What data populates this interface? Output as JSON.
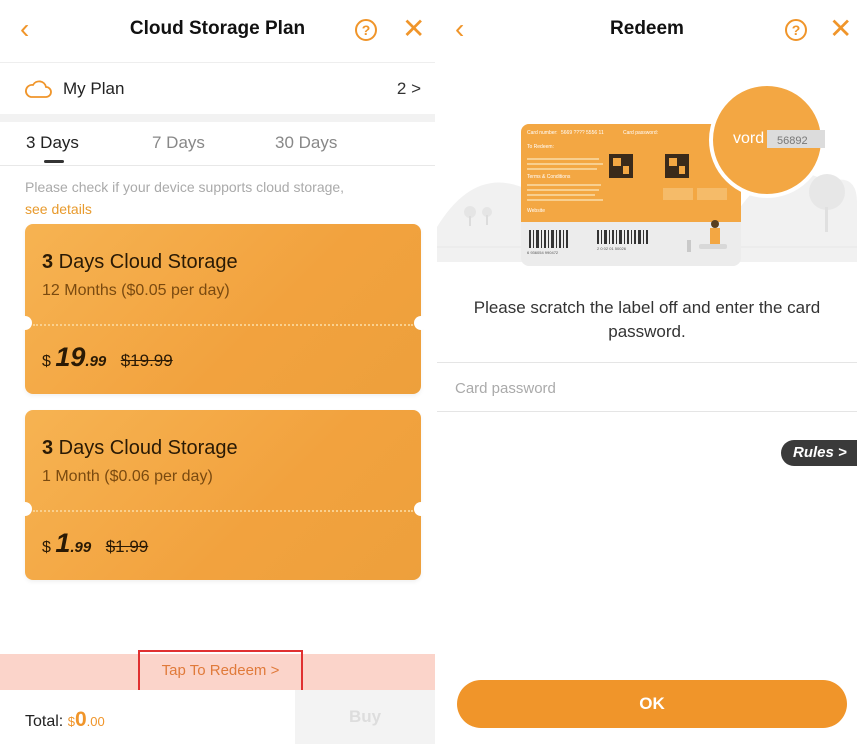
{
  "left": {
    "header": {
      "title": "Cloud Storage Plan",
      "help": "?",
      "close": "✕",
      "back": "‹"
    },
    "my_plan": {
      "label": "My Plan",
      "count": "2 >"
    },
    "tabs": [
      {
        "label": "3 Days"
      },
      {
        "label": "7 Days"
      },
      {
        "label": "30 Days"
      }
    ],
    "notice": {
      "text": "Please check if your device supports cloud storage,",
      "link": "see details"
    },
    "cards": [
      {
        "days": "3",
        "title_rest": " Days Cloud Storage",
        "subtitle": "12 Months ($0.05 per day)",
        "currency": "$",
        "price_int": "19",
        "price_dec": ".99",
        "old_price": "$19.99"
      },
      {
        "days": "3",
        "title_rest": " Days Cloud Storage",
        "subtitle": "1 Month ($0.06 per day)",
        "currency": "$",
        "price_int": "1",
        "price_dec": ".99",
        "old_price": "$1.99"
      }
    ],
    "redeem_label": "Tap To Redeem >",
    "footer": {
      "total_label": "Total:",
      "currency": "$",
      "amount_int": "0",
      "amount_dec": ".00",
      "buy_label": "Buy"
    }
  },
  "right": {
    "header": {
      "title": "Redeem",
      "help": "?",
      "close": "✕",
      "back": "‹"
    },
    "card_graphic": {
      "card_number_label": "Card number:",
      "card_number": "5669 ???? 5556 11",
      "card_password_label": "Card password:",
      "to_redeem": "To Redeem:",
      "terms": "Terms & Conditions",
      "website": "Website",
      "magnifier_word": "vord",
      "magnifier_code": "56892",
      "barcode_left": "6 936054 990472",
      "barcode_right": "2 0 02 01 50026"
    },
    "instruction": "Please scratch the label off and enter the card password.",
    "password_placeholder": "Card password",
    "rules_label": "Rules >",
    "ok_label": "OK"
  },
  "colors": {
    "accent": "#f0952a",
    "card": "#f3a743",
    "redeem_bar": "#fbd4ca",
    "highlight_border": "#e03030"
  }
}
